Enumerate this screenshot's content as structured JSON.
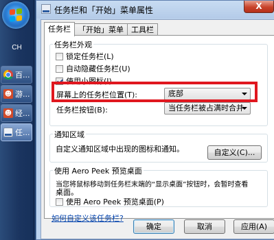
{
  "taskbar": {
    "language": "CH",
    "buttons": [
      {
        "label": "百...",
        "icon": "chrome-icon"
      },
      {
        "label": "游...",
        "icon": "users-icon"
      },
      {
        "label": "经...",
        "icon": "users-icon"
      },
      {
        "label": "任...",
        "icon": "taskbar-properties-icon"
      }
    ]
  },
  "dialog": {
    "title": "任务栏和「开始」菜单属性",
    "close_label": "X",
    "tabs": [
      "任务栏",
      "「开始」菜单",
      "工具栏"
    ],
    "appearance": {
      "title": "任务栏外观",
      "lock_label": "锁定任务栏(L)",
      "lock_checked": false,
      "autohide_label": "自动隐藏任务栏(U)",
      "autohide_checked": false,
      "small_icons_label": "使用小图标(I)",
      "small_icons_checked": true,
      "location_label": "屏幕上的任务栏位置(T):",
      "location_value": "底部",
      "buttons_label": "任务栏按钮(B):",
      "buttons_value": "当任务栏被占满时合并"
    },
    "notification": {
      "title": "通知区域",
      "description": "自定义通知区域中出现的图标和通知。",
      "customize_button": "自定义(C)..."
    },
    "aero_peek": {
      "title": "使用 Aero Peek 预览桌面",
      "description_line1": "当您将鼠标移动到任务栏末端的“显示桌面”按钮时，会暂时查看",
      "description_line2": "桌面。",
      "checkbox_label": "使用 Aero Peek 预览桌面(P)",
      "checked": false
    },
    "help_link": "如何自定义该任务栏?",
    "footer": {
      "ok": "确定",
      "cancel": "取消",
      "apply": "应用(A)"
    }
  }
}
